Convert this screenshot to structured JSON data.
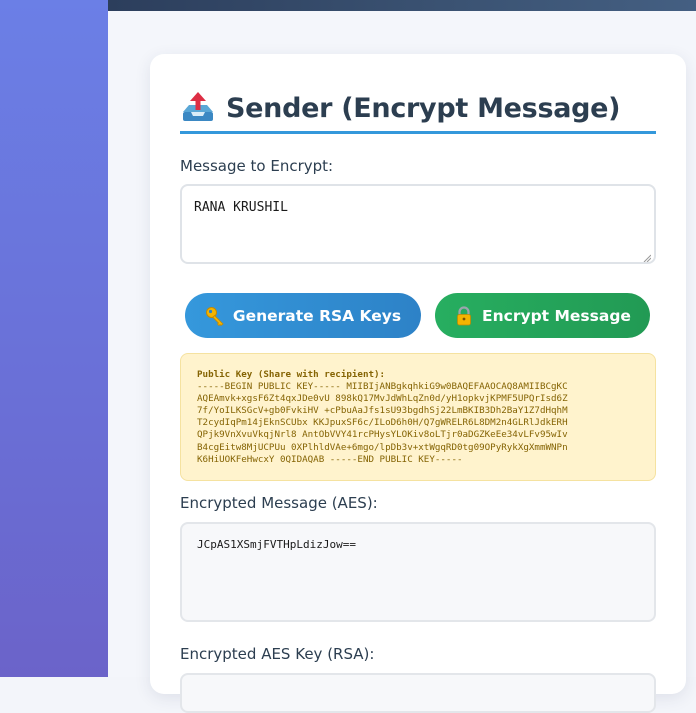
{
  "sender": {
    "title": "Sender (Encrypt Message)",
    "title_icon": "outbox-tray-icon",
    "message_label": "Message to Encrypt:",
    "message_value": "RANA KRUSHIL",
    "buttons": {
      "generate_rsa": {
        "label": "Generate RSA Keys",
        "icon": "key-icon"
      },
      "encrypt": {
        "label": "Encrypt Message",
        "icon": "lock-icon"
      }
    },
    "public_key": {
      "title": "Public Key (Share with recipient):",
      "lines": [
        "-----BEGIN PUBLIC KEY----- MIIBIjANBgkqhkiG9w0BAQEFAAOCAQ8AMIIBCgKC",
        "AQEAmvk+xgsF6Zt4qxJDe0vU 898kQ17MvJdWhLqZn0d/yH1opkvjKPMF5UPQrIsd6Z",
        "7f/YoILKSGcV+gb0FvkiHV +cPbuAaJfs1sU93bgdhSj22LmBKIB3Dh2BaY1Z7dHqhM",
        "T2cydIqPm14jEknSCUbx KKJpuxSF6c/ILoD6h0H/Q7gWRELR6L8DM2n4GLRlJdkERH",
        "QPjk9VnXvuVkqjNrl8 AntObVVY41rcPHysYLOKiv8oLTjr0aDGZKeEe34vLFv95wIv",
        "B4cgEitw8MjUCPUu 0XPlhldVAe+6mgo/lpDb3v+xtWgqRD0tg09OPyRykXgXmmWNPn",
        "K6HiUOKFeHwcxY 0QIDAQAB -----END PUBLIC KEY-----"
      ]
    },
    "encrypted_message_label": "Encrypted Message (AES):",
    "encrypted_message_value": "JCpAS1XSmjFVTHpLdizJow==",
    "encrypted_key_label": "Encrypted AES Key (RSA):"
  },
  "colors": {
    "accent_blue": "#3498db",
    "accent_green": "#27ae60",
    "title_text": "#2c3e50",
    "key_box_bg": "#fff3cd",
    "key_box_text": "#856404"
  }
}
